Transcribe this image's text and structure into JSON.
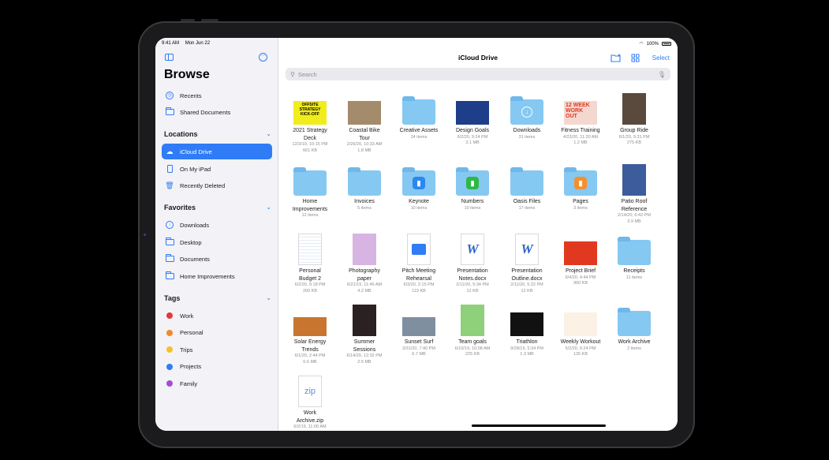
{
  "status": {
    "time": "9:41 AM",
    "date": "Mon Jun 22",
    "battery": "100%"
  },
  "sidebar": {
    "title": "Browse",
    "top_items": [
      {
        "label": "Recents",
        "icon": "clock-icon"
      },
      {
        "label": "Shared Documents",
        "icon": "shared-folder-icon"
      }
    ],
    "locations": {
      "header": "Locations",
      "items": [
        {
          "label": "iCloud Drive",
          "icon": "cloud-icon",
          "selected": true
        },
        {
          "label": "On My iPad",
          "icon": "ipad-icon"
        },
        {
          "label": "Recently Deleted",
          "icon": "trash-icon"
        }
      ]
    },
    "favorites": {
      "header": "Favorites",
      "items": [
        {
          "label": "Downloads",
          "icon": "download-circle-icon"
        },
        {
          "label": "Desktop",
          "icon": "folder-icon"
        },
        {
          "label": "Documents",
          "icon": "folder-icon"
        },
        {
          "label": "Home Improvements",
          "icon": "folder-icon"
        }
      ]
    },
    "tags": {
      "header": "Tags",
      "items": [
        {
          "label": "Work",
          "color": "#e0393e"
        },
        {
          "label": "Personal",
          "color": "#f08a2b"
        },
        {
          "label": "Trips",
          "color": "#f5c02c"
        },
        {
          "label": "Projects",
          "color": "#2f7cf6"
        },
        {
          "label": "Family",
          "color": "#a04fd0"
        }
      ]
    }
  },
  "main": {
    "title": "iCloud Drive",
    "select_label": "Select",
    "search_placeholder": "Search",
    "files": [
      {
        "name1": "2021 Strategy",
        "name2": "Deck",
        "meta1": "12/3/19, 10:15 PM",
        "meta2": "661 KB",
        "kind": "img",
        "bg": "#f1ec1c"
      },
      {
        "name1": "Coastal Bike",
        "name2": "Tour",
        "meta1": "2/26/20, 10:33 AM",
        "meta2": "1.8 MB",
        "kind": "img",
        "bg": "#a38b6b"
      },
      {
        "name1": "Creative Assets",
        "name2": "",
        "meta1": "24 items",
        "meta2": "",
        "kind": "folder"
      },
      {
        "name1": "Design Goals",
        "name2": "",
        "meta1": "6/2/20, 9:24 PM",
        "meta2": "3.1 MB",
        "kind": "img",
        "bg": "#1e3e8a"
      },
      {
        "name1": "Downloads",
        "name2": "",
        "meta1": "31 items",
        "meta2": "",
        "kind": "folder-dl"
      },
      {
        "name1": "Fitness Training",
        "name2": "",
        "meta1": "4/23/20, 11:30 AM",
        "meta2": "1.2 MB",
        "kind": "img",
        "bg": "#f4d8cf"
      },
      {
        "name1": "Group Ride",
        "name2": "",
        "meta1": "6/1/20, 9:31 PM",
        "meta2": "275 KB",
        "kind": "img-tall",
        "bg": "#5a4a3e"
      },
      {
        "name1": "Home",
        "name2": "Improvements",
        "meta1": "12 items",
        "meta2": "",
        "kind": "folder"
      },
      {
        "name1": "Invoices",
        "name2": "",
        "meta1": "5 items",
        "meta2": "",
        "kind": "folder"
      },
      {
        "name1": "Keynote",
        "name2": "",
        "meta1": "10 items",
        "meta2": "",
        "kind": "folder-app",
        "bg": "#2d87f0"
      },
      {
        "name1": "Numbers",
        "name2": "",
        "meta1": "10 items",
        "meta2": "",
        "kind": "folder-app",
        "bg": "#2fb845"
      },
      {
        "name1": "Oasis Files",
        "name2": "",
        "meta1": "17 items",
        "meta2": "",
        "kind": "folder"
      },
      {
        "name1": "Pages",
        "name2": "",
        "meta1": "3 items",
        "meta2": "",
        "kind": "folder-app",
        "bg": "#f4902c"
      },
      {
        "name1": "Patio Roof",
        "name2": "Reference",
        "meta1": "2/14/20, 6:42 PM",
        "meta2": "3.9 MB",
        "kind": "img-tall",
        "bg": "#3c5c9c"
      },
      {
        "name1": "Personal",
        "name2": "Budget 2",
        "meta1": "6/2/20, 9:18 PM",
        "meta2": "200 KB",
        "kind": "doc-sheet"
      },
      {
        "name1": "Photography",
        "name2": "paper",
        "meta1": "6/21/19, 11:46 AM",
        "meta2": "4.2 MB",
        "kind": "img-tall",
        "bg": "#d8b4e2"
      },
      {
        "name1": "Pitch Meeting",
        "name2": "Rehearsal",
        "meta1": "6/3/20, 2:15 PM",
        "meta2": "119 KB",
        "kind": "doc-audio"
      },
      {
        "name1": "Presentation",
        "name2": "Notes.docx",
        "meta1": "2/11/20, 5:34 PM",
        "meta2": "12 KB",
        "kind": "doc-w"
      },
      {
        "name1": "Presentation",
        "name2": "Outline.docx",
        "meta1": "2/11/20, 5:22 PM",
        "meta2": "12 KB",
        "kind": "doc-w"
      },
      {
        "name1": "Project Brief",
        "name2": "",
        "meta1": "6/4/20, 4:44 PM",
        "meta2": "900 KB",
        "kind": "img",
        "bg": "#e0391f"
      },
      {
        "name1": "Receipts",
        "name2": "",
        "meta1": "11 items",
        "meta2": "",
        "kind": "folder"
      },
      {
        "name1": "Solar Energy",
        "name2": "Trends",
        "meta1": "6/1/20, 2:44 PM",
        "meta2": "6.6 MB",
        "kind": "img-wide",
        "bg": "#c8762f"
      },
      {
        "name1": "Summer",
        "name2": "Sessions",
        "meta1": "6/14/20, 12:32 PM",
        "meta2": "2.5 MB",
        "kind": "img-tall",
        "bg": "#2b2022"
      },
      {
        "name1": "Sunset Surf",
        "name2": "",
        "meta1": "3/31/20, 7:40 PM",
        "meta2": "6.7 MB",
        "kind": "img-wide",
        "bg": "#7f8fa0"
      },
      {
        "name1": "Team goals",
        "name2": "",
        "meta1": "6/10/19, 10:08 AM",
        "meta2": "225 KB",
        "kind": "img-tall",
        "bg": "#8fd07a"
      },
      {
        "name1": "Triathlon",
        "name2": "",
        "meta1": "9/28/19, 5:34 PM",
        "meta2": "1.3 MB",
        "kind": "img",
        "bg": "#111111"
      },
      {
        "name1": "Weekly Workout",
        "name2": "",
        "meta1": "5/2/20, 6:24 PM",
        "meta2": "135 KB",
        "kind": "img",
        "bg": "#fbf1e4"
      },
      {
        "name1": "Work Archive",
        "name2": "",
        "meta1": "2 items",
        "meta2": "",
        "kind": "folder"
      },
      {
        "name1": "Work",
        "name2": "Archive.zip",
        "meta1": "6/2/19, 11:00 AM",
        "meta2": "",
        "kind": "doc-zip"
      }
    ],
    "thumb_text": {
      "strategy": "OFFSITE STRATEGY KICK-OFF",
      "fitness": "12 WEEK WORK OUT",
      "zip": "zip",
      "w": "W"
    }
  }
}
